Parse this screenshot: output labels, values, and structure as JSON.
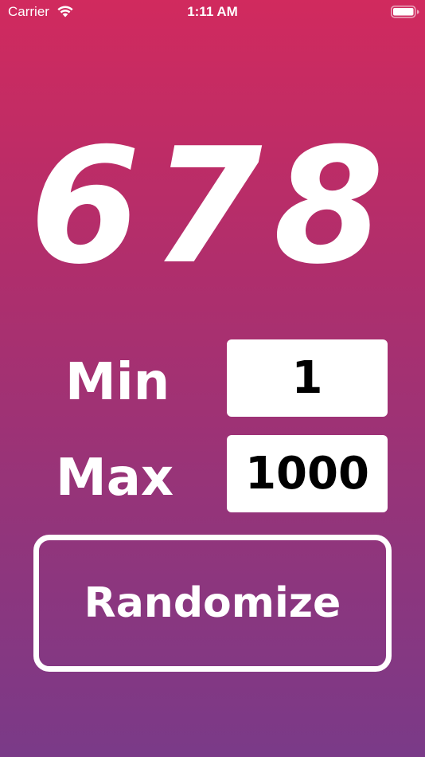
{
  "status_bar": {
    "carrier": "Carrier",
    "time": "1:11 AM",
    "wifi_icon": "wifi-icon",
    "battery_icon": "battery-icon"
  },
  "result": {
    "value": "678"
  },
  "min": {
    "label": "Min",
    "value": "1"
  },
  "max": {
    "label": "Max",
    "value": "1000"
  },
  "randomize": {
    "label": "Randomize"
  },
  "colors": {
    "gradient_top": "#d12a5e",
    "gradient_bottom": "#7a3a88",
    "text": "#ffffff",
    "field_bg": "#ffffff",
    "field_text": "#000000"
  }
}
